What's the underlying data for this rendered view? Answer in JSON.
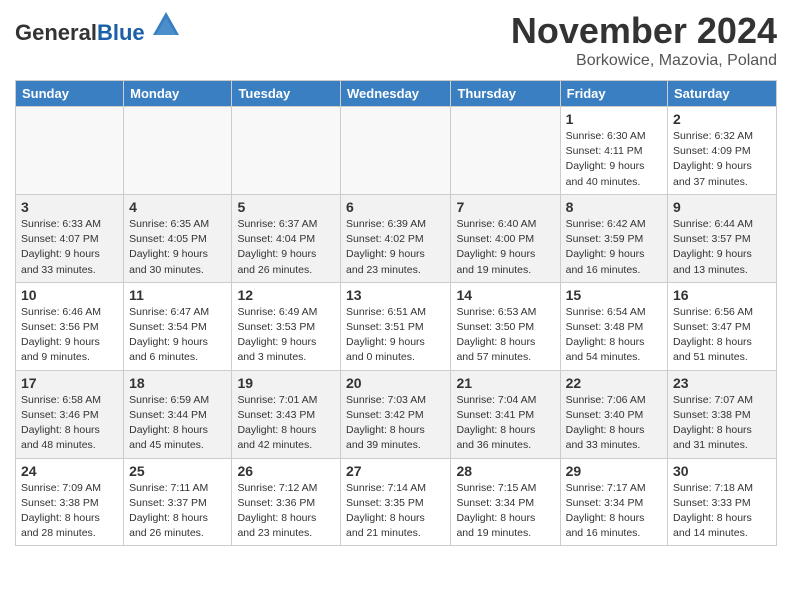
{
  "header": {
    "logo_general": "General",
    "logo_blue": "Blue",
    "month_title": "November 2024",
    "location": "Borkowice, Mazovia, Poland"
  },
  "weekdays": [
    "Sunday",
    "Monday",
    "Tuesday",
    "Wednesday",
    "Thursday",
    "Friday",
    "Saturday"
  ],
  "weeks": [
    [
      {
        "day": "",
        "info": ""
      },
      {
        "day": "",
        "info": ""
      },
      {
        "day": "",
        "info": ""
      },
      {
        "day": "",
        "info": ""
      },
      {
        "day": "",
        "info": ""
      },
      {
        "day": "1",
        "info": "Sunrise: 6:30 AM\nSunset: 4:11 PM\nDaylight: 9 hours\nand 40 minutes."
      },
      {
        "day": "2",
        "info": "Sunrise: 6:32 AM\nSunset: 4:09 PM\nDaylight: 9 hours\nand 37 minutes."
      }
    ],
    [
      {
        "day": "3",
        "info": "Sunrise: 6:33 AM\nSunset: 4:07 PM\nDaylight: 9 hours\nand 33 minutes."
      },
      {
        "day": "4",
        "info": "Sunrise: 6:35 AM\nSunset: 4:05 PM\nDaylight: 9 hours\nand 30 minutes."
      },
      {
        "day": "5",
        "info": "Sunrise: 6:37 AM\nSunset: 4:04 PM\nDaylight: 9 hours\nand 26 minutes."
      },
      {
        "day": "6",
        "info": "Sunrise: 6:39 AM\nSunset: 4:02 PM\nDaylight: 9 hours\nand 23 minutes."
      },
      {
        "day": "7",
        "info": "Sunrise: 6:40 AM\nSunset: 4:00 PM\nDaylight: 9 hours\nand 19 minutes."
      },
      {
        "day": "8",
        "info": "Sunrise: 6:42 AM\nSunset: 3:59 PM\nDaylight: 9 hours\nand 16 minutes."
      },
      {
        "day": "9",
        "info": "Sunrise: 6:44 AM\nSunset: 3:57 PM\nDaylight: 9 hours\nand 13 minutes."
      }
    ],
    [
      {
        "day": "10",
        "info": "Sunrise: 6:46 AM\nSunset: 3:56 PM\nDaylight: 9 hours\nand 9 minutes."
      },
      {
        "day": "11",
        "info": "Sunrise: 6:47 AM\nSunset: 3:54 PM\nDaylight: 9 hours\nand 6 minutes."
      },
      {
        "day": "12",
        "info": "Sunrise: 6:49 AM\nSunset: 3:53 PM\nDaylight: 9 hours\nand 3 minutes."
      },
      {
        "day": "13",
        "info": "Sunrise: 6:51 AM\nSunset: 3:51 PM\nDaylight: 9 hours\nand 0 minutes."
      },
      {
        "day": "14",
        "info": "Sunrise: 6:53 AM\nSunset: 3:50 PM\nDaylight: 8 hours\nand 57 minutes."
      },
      {
        "day": "15",
        "info": "Sunrise: 6:54 AM\nSunset: 3:48 PM\nDaylight: 8 hours\nand 54 minutes."
      },
      {
        "day": "16",
        "info": "Sunrise: 6:56 AM\nSunset: 3:47 PM\nDaylight: 8 hours\nand 51 minutes."
      }
    ],
    [
      {
        "day": "17",
        "info": "Sunrise: 6:58 AM\nSunset: 3:46 PM\nDaylight: 8 hours\nand 48 minutes."
      },
      {
        "day": "18",
        "info": "Sunrise: 6:59 AM\nSunset: 3:44 PM\nDaylight: 8 hours\nand 45 minutes."
      },
      {
        "day": "19",
        "info": "Sunrise: 7:01 AM\nSunset: 3:43 PM\nDaylight: 8 hours\nand 42 minutes."
      },
      {
        "day": "20",
        "info": "Sunrise: 7:03 AM\nSunset: 3:42 PM\nDaylight: 8 hours\nand 39 minutes."
      },
      {
        "day": "21",
        "info": "Sunrise: 7:04 AM\nSunset: 3:41 PM\nDaylight: 8 hours\nand 36 minutes."
      },
      {
        "day": "22",
        "info": "Sunrise: 7:06 AM\nSunset: 3:40 PM\nDaylight: 8 hours\nand 33 minutes."
      },
      {
        "day": "23",
        "info": "Sunrise: 7:07 AM\nSunset: 3:38 PM\nDaylight: 8 hours\nand 31 minutes."
      }
    ],
    [
      {
        "day": "24",
        "info": "Sunrise: 7:09 AM\nSunset: 3:38 PM\nDaylight: 8 hours\nand 28 minutes."
      },
      {
        "day": "25",
        "info": "Sunrise: 7:11 AM\nSunset: 3:37 PM\nDaylight: 8 hours\nand 26 minutes."
      },
      {
        "day": "26",
        "info": "Sunrise: 7:12 AM\nSunset: 3:36 PM\nDaylight: 8 hours\nand 23 minutes."
      },
      {
        "day": "27",
        "info": "Sunrise: 7:14 AM\nSunset: 3:35 PM\nDaylight: 8 hours\nand 21 minutes."
      },
      {
        "day": "28",
        "info": "Sunrise: 7:15 AM\nSunset: 3:34 PM\nDaylight: 8 hours\nand 19 minutes."
      },
      {
        "day": "29",
        "info": "Sunrise: 7:17 AM\nSunset: 3:34 PM\nDaylight: 8 hours\nand 16 minutes."
      },
      {
        "day": "30",
        "info": "Sunrise: 7:18 AM\nSunset: 3:33 PM\nDaylight: 8 hours\nand 14 minutes."
      }
    ]
  ]
}
